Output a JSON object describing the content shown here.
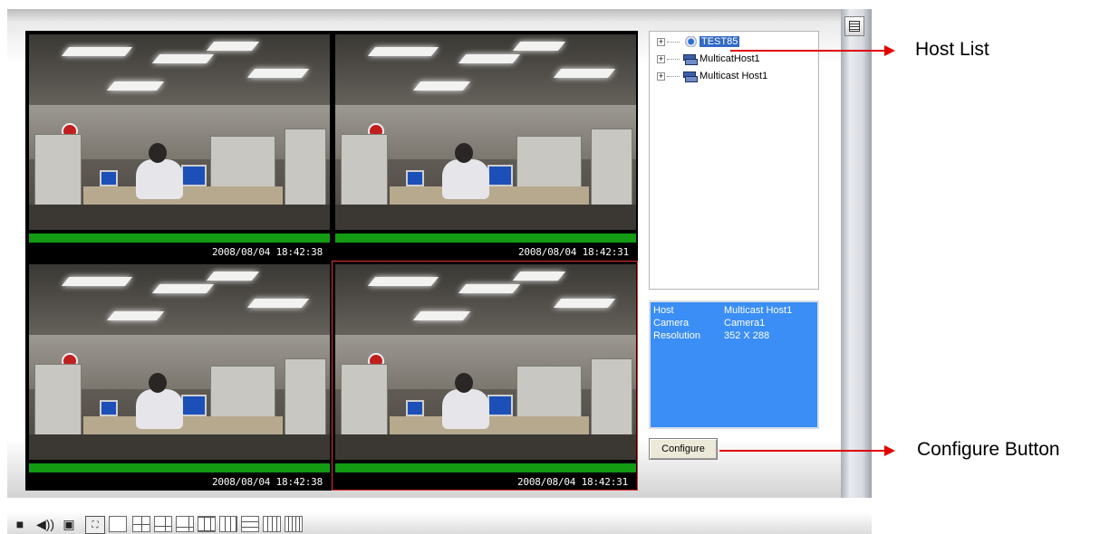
{
  "cameras": [
    {
      "timestamp": "2008/08/04 18:42:38"
    },
    {
      "timestamp": "2008/08/04 18:42:31"
    },
    {
      "timestamp": "2008/08/04 18:42:38"
    },
    {
      "timestamp": "2008/08/04 18:42:31"
    }
  ],
  "host_tree": {
    "items": [
      {
        "label": "TEST85",
        "icon": "camera-host-icon",
        "selected": true
      },
      {
        "label": "MulticatHost1",
        "icon": "multicast-host-icon",
        "selected": false
      },
      {
        "label": "Multicast Host1",
        "icon": "multicast-host-icon",
        "selected": false
      }
    ]
  },
  "info_panel": {
    "host_label": "Host",
    "host_value": "Multicast Host1",
    "camera_label": "Camera",
    "camera_value": "Camera1",
    "resolution_label": "Resolution",
    "resolution_value": "352 X 288"
  },
  "configure_label": "Configure",
  "toolbar": {
    "icons": [
      "stop-icon",
      "speaker-icon",
      "snapshot-icon",
      "fullscreen-icon",
      "layout-1-icon",
      "layout-4-icon",
      "layout-6-icon",
      "layout-8-icon",
      "layout-9-icon",
      "layout-10-icon",
      "layout-13-icon",
      "layout-16-icon",
      "layout-25-icon"
    ]
  },
  "annotations": {
    "host_list": "Host List",
    "configure_button": "Configure Button"
  },
  "colors": {
    "selection_border": "#e03030",
    "info_panel": "#3a8ef5",
    "status_bar": "#139b13",
    "annotation_arrow": "#e00000"
  }
}
